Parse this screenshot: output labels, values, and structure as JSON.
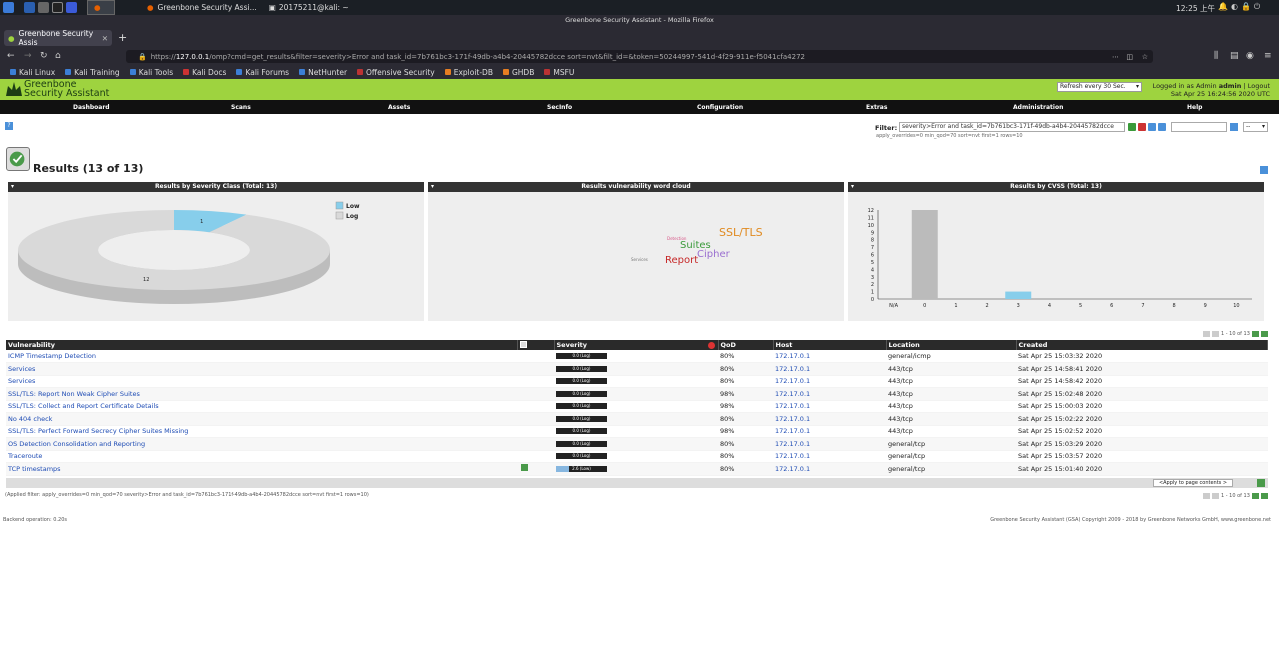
{
  "taskbar": {
    "items": [
      "Greenbone Security Assi...",
      "20175211@kali: ~"
    ],
    "clock": "12:25 上午"
  },
  "browser": {
    "window_title": "Greenbone Security Assistant - Mozilla Firefox",
    "tab_title": "Greenbone Security Assis",
    "url_prefix": "https://",
    "url_host": "127.0.0.1",
    "url_rest": "/omp?cmd=get_results&filter=severity>Error and task_id=7b761bc3-171f-49db-a4b4-20445782dcce sort=nvt&filt_id=&token=50244997-541d-4f29-911e-f5041cfa4272",
    "bookmarks": [
      "Kali Linux",
      "Kali Training",
      "Kali Tools",
      "Kali Docs",
      "Kali Forums",
      "NetHunter",
      "Offensive Security",
      "Exploit-DB",
      "GHDB",
      "MSFU"
    ]
  },
  "gsa": {
    "logo_line1": "Greenbone",
    "logo_line2": "Security Assistant",
    "refresh": "Refresh every 30 Sec.",
    "logged_in_label": "Logged in as",
    "role": "Admin",
    "user": "admin",
    "logout": "Logout",
    "datetime": "Sat Apr 25 16:24:56 2020 UTC",
    "menu": [
      "Dashboard",
      "Scans",
      "Assets",
      "SecInfo",
      "Configuration",
      "Extras",
      "Administration",
      "Help"
    ],
    "filter_label": "Filter:",
    "filter_value": "severity>Error and task_id=7b761bc3-171f-49db-a4b4-20445782dcce",
    "filter_sub": "apply_overrides=0 min_qod=70 sort=nvt first=1 rows=10",
    "page_select": "--",
    "results_title": "Results (13 of 13)"
  },
  "panels": {
    "severity_title": "Results by Severity Class (Total: 13)",
    "wordcloud_title": "Results vulnerability word cloud",
    "cvss_title": "Results by CVSS (Total: 13)"
  },
  "chart_data": [
    {
      "type": "pie",
      "title": "Results by Severity Class (Total: 13)",
      "categories": [
        "Low",
        "Log"
      ],
      "values": [
        1,
        12
      ],
      "colors": [
        "#87ceeb",
        "#d9d9d9"
      ],
      "legend": "top-right"
    },
    {
      "type": "bar",
      "title": "Results by CVSS (Total: 13)",
      "categories": [
        "N/A",
        "0",
        "1",
        "2",
        "3",
        "4",
        "5",
        "6",
        "7",
        "8",
        "9",
        "10"
      ],
      "values": [
        0,
        12,
        0,
        0,
        1,
        0,
        0,
        0,
        0,
        0,
        0,
        0
      ],
      "colors": [
        "#bbbbbb",
        "#bbbbbb",
        "#87ceeb",
        "#87ceeb",
        "#87ceeb",
        "#87ceeb",
        "#f0a030",
        "#f0a030",
        "#d04040",
        "#d04040",
        "#d04040",
        "#d04040"
      ],
      "yticks": [
        "0",
        "1",
        "2",
        "3",
        "4",
        "5",
        "6",
        "7",
        "8",
        "9",
        "10",
        "11",
        "12"
      ],
      "ylim": [
        0,
        12
      ]
    }
  ],
  "wordcloud": [
    {
      "word": "SSL/TLS",
      "color": "#e08a20"
    },
    {
      "word": "Suites",
      "color": "#3a9a3a"
    },
    {
      "word": "Cipher",
      "color": "#9a6fd0"
    },
    {
      "word": "Report",
      "color": "#c62828"
    },
    {
      "word": "Detection",
      "color": "#d85a8a"
    },
    {
      "word": "Services",
      "color": "#777777"
    }
  ],
  "table": {
    "headers": [
      "Vulnerability",
      "Severity",
      "QoD",
      "Host",
      "Location",
      "Created"
    ],
    "rows": [
      {
        "vuln": "ICMP Timestamp Detection",
        "sev": "0.0 (Log)",
        "qod": "80%",
        "host": "172.17.0.1",
        "loc": "general/icmp",
        "created": "Sat Apr 25 15:03:32 2020"
      },
      {
        "vuln": "Services",
        "sev": "0.0 (Log)",
        "qod": "80%",
        "host": "172.17.0.1",
        "loc": "443/tcp",
        "created": "Sat Apr 25 14:58:41 2020"
      },
      {
        "vuln": "Services",
        "sev": "0.0 (Log)",
        "qod": "80%",
        "host": "172.17.0.1",
        "loc": "443/tcp",
        "created": "Sat Apr 25 14:58:42 2020"
      },
      {
        "vuln": "SSL/TLS: Report Non Weak Cipher Suites",
        "sev": "0.0 (Log)",
        "qod": "98%",
        "host": "172.17.0.1",
        "loc": "443/tcp",
        "created": "Sat Apr 25 15:02:48 2020"
      },
      {
        "vuln": "SSL/TLS: Collect and Report Certificate Details",
        "sev": "0.0 (Log)",
        "qod": "98%",
        "host": "172.17.0.1",
        "loc": "443/tcp",
        "created": "Sat Apr 25 15:00:03 2020"
      },
      {
        "vuln": "No 404 check",
        "sev": "0.0 (Log)",
        "qod": "80%",
        "host": "172.17.0.1",
        "loc": "443/tcp",
        "created": "Sat Apr 25 15:02:22 2020"
      },
      {
        "vuln": "SSL/TLS: Perfect Forward Secrecy Cipher Suites Missing",
        "sev": "0.0 (Log)",
        "qod": "98%",
        "host": "172.17.0.1",
        "loc": "443/tcp",
        "created": "Sat Apr 25 15:02:52 2020"
      },
      {
        "vuln": "OS Detection Consolidation and Reporting",
        "sev": "0.0 (Log)",
        "qod": "80%",
        "host": "172.17.0.1",
        "loc": "general/tcp",
        "created": "Sat Apr 25 15:03:29 2020"
      },
      {
        "vuln": "Traceroute",
        "sev": "0.0 (Log)",
        "qod": "80%",
        "host": "172.17.0.1",
        "loc": "general/tcp",
        "created": "Sat Apr 25 15:03:57 2020"
      },
      {
        "vuln": "TCP timestamps",
        "sev": "2.6 (Low)",
        "qod": "80%",
        "host": "172.17.0.1",
        "loc": "general/tcp",
        "created": "Sat Apr 25 15:01:40 2020"
      }
    ],
    "pager": "1 - 10 of 13",
    "apply_to": "<Apply to page contents >",
    "applied_filter": "(Applied filter: apply_overrides=0 min_qod=70 severity>Error and task_id=7b761bc3-171f-49db-a4b4-20445782dcce sort=nvt first=1 rows=10)"
  },
  "footer": {
    "backend": "Backend operation: 0.20s",
    "copyright": "Greenbone Security Assistant (GSA) Copyright 2009 - 2018 by Greenbone Networks GmbH, www.greenbone.net"
  }
}
